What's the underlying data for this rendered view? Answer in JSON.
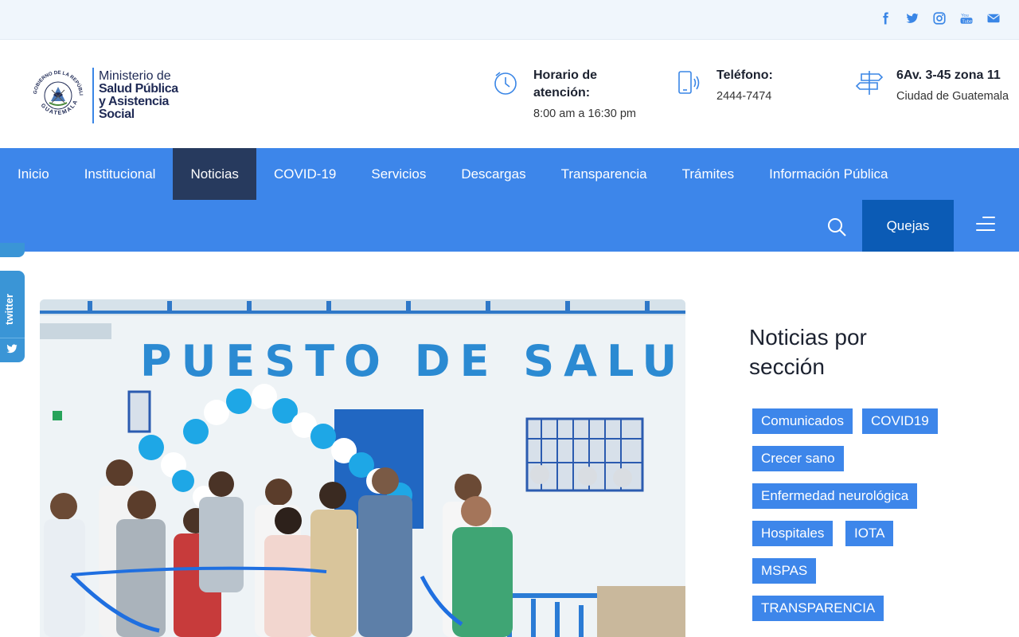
{
  "social": [
    "facebook-icon",
    "twitter-icon",
    "instagram-icon",
    "youtube-icon",
    "email-icon"
  ],
  "logo": {
    "ring_text": "GOBIERNO DE LA REPÚBLICA",
    "country": "GUATEMALA",
    "line1": "Ministerio de",
    "line2": "Salud Pública",
    "line3": "y Asistencia",
    "line4": "Social"
  },
  "info": {
    "hours": {
      "title": "Horario de atención:",
      "value": "8:00 am a 16:30 pm"
    },
    "phone": {
      "title": "Teléfono:",
      "value": "2444-7474"
    },
    "address": {
      "title": "6Av. 3-45 zona 11",
      "value": "Ciudad de Guatemala"
    }
  },
  "nav": {
    "items": [
      "Inicio",
      "Institucional",
      "Noticias",
      "COVID-19",
      "Servicios",
      "Descargas",
      "Transparencia",
      "Trámites",
      "Información Pública"
    ],
    "active": "Noticias",
    "quejas": "Quejas"
  },
  "floating": {
    "twitter_label": "twitter"
  },
  "photo": {
    "sign_text": "PUESTO DE SALUD"
  },
  "sidebar": {
    "title": "Noticias por sección",
    "tags": [
      "Comunicados",
      "COVID19",
      "Crecer sano",
      "Enfermedad neurológica",
      "Hospitales",
      "IOTA",
      "MSPAS",
      "TRANSPARENCIA"
    ]
  },
  "colors": {
    "primary": "#3d86ea",
    "active_nav": "#273a5e",
    "quejas": "#0b5bb5",
    "topbar": "#f0f6fc",
    "twitter_tab": "#3a95d6"
  }
}
